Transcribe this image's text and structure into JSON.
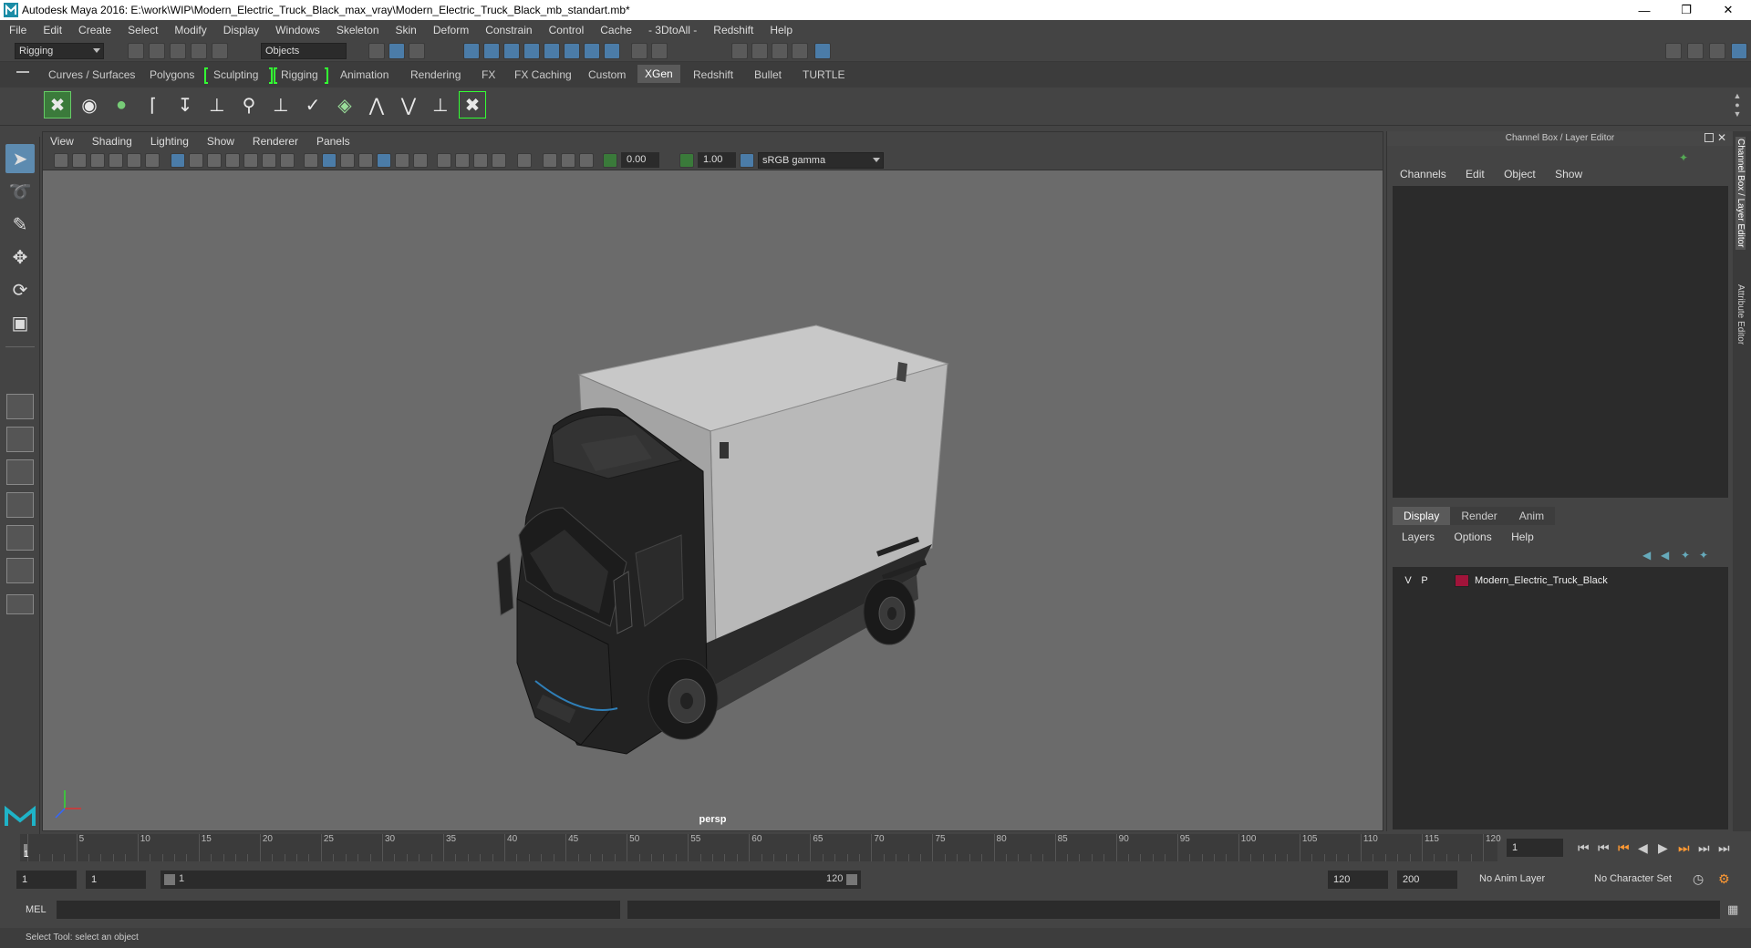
{
  "window": {
    "title": "Autodesk Maya 2016: E:\\work\\WIP\\Modern_Electric_Truck_Black_max_vray\\Modern_Electric_Truck_Black_mb_standart.mb*"
  },
  "menubar": [
    "File",
    "Edit",
    "Create",
    "Select",
    "Modify",
    "Display",
    "Windows",
    "Skeleton",
    "Skin",
    "Deform",
    "Constrain",
    "Control",
    "Cache",
    "- 3DtoAll -",
    "Redshift",
    "Help"
  ],
  "statusline": {
    "menuset": "Rigging",
    "selection_mode": "Objects"
  },
  "shelf_tabs": [
    "Curves / Surfaces",
    "Polygons",
    "Sculpting",
    "Rigging",
    "Animation",
    "Rendering",
    "FX",
    "FX Caching",
    "Custom",
    "XGen",
    "Redshift",
    "Bullet",
    "TURTLE"
  ],
  "shelf_active": "XGen",
  "viewport": {
    "menus": [
      "View",
      "Shading",
      "Lighting",
      "Show",
      "Renderer",
      "Panels"
    ],
    "exposure": "0.00",
    "gamma": "1.00",
    "color_space": "sRGB gamma",
    "camera_label": "persp"
  },
  "channel_box": {
    "title": "Channel Box / Layer Editor",
    "menus": [
      "Channels",
      "Edit",
      "Object",
      "Show"
    ],
    "side_tab_1": "Channel Box / Layer Editor",
    "side_tab_2": "Attribute Editor"
  },
  "layer_editor": {
    "tabs": [
      "Display",
      "Render",
      "Anim"
    ],
    "active_tab": "Display",
    "menus": [
      "Layers",
      "Options",
      "Help"
    ],
    "layers": [
      {
        "v": "V",
        "p": "P",
        "name": "Modern_Electric_Truck_Black",
        "color": "#a0143a"
      }
    ]
  },
  "timeline": {
    "ticks": [
      "1",
      "5",
      "10",
      "15",
      "20",
      "25",
      "30",
      "35",
      "40",
      "45",
      "50",
      "55",
      "60",
      "65",
      "70",
      "75",
      "80",
      "85",
      "90",
      "95",
      "100",
      "105",
      "110",
      "115",
      "120"
    ],
    "current_frame": "1"
  },
  "range": {
    "start": "1",
    "anim_start": "1",
    "slider_start": "1",
    "slider_end": "120",
    "end": "120",
    "anim_end": "200",
    "anim_layer": "No Anim Layer",
    "character_set": "No Character Set"
  },
  "mel": {
    "label": "MEL"
  },
  "help_line": "Select Tool: select an object"
}
